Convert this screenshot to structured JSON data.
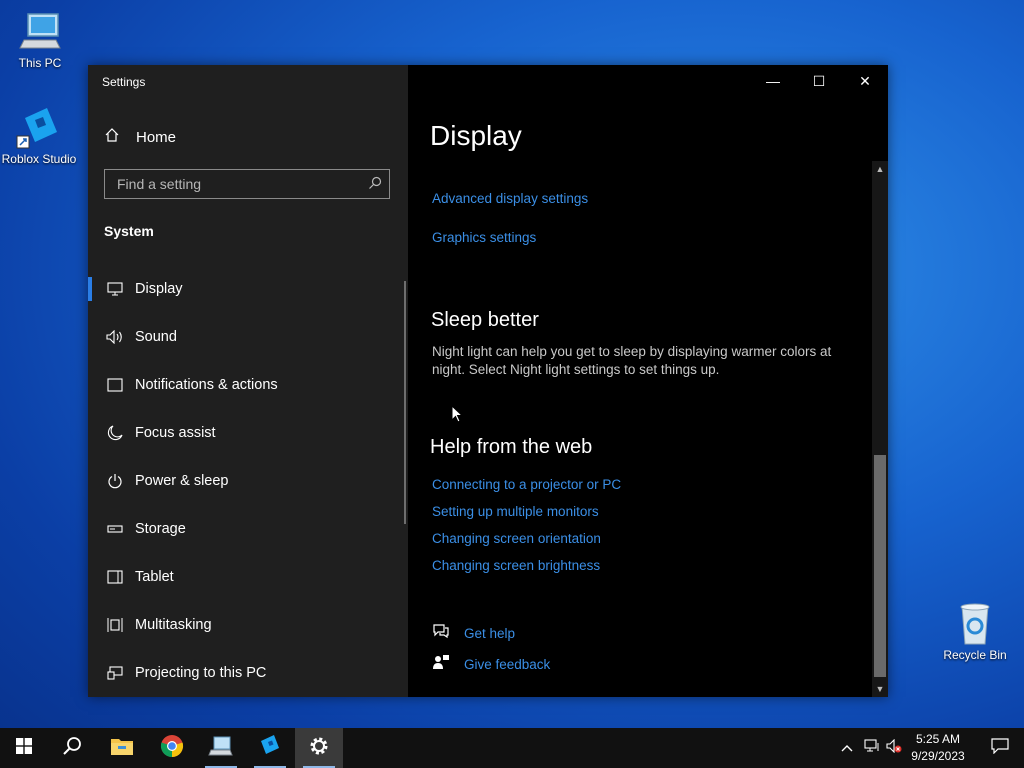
{
  "desktop": {
    "icons": [
      {
        "label": "This PC"
      },
      {
        "label": "Roblox Studio"
      },
      {
        "label": "Recycle Bin"
      }
    ]
  },
  "window": {
    "title": "Settings",
    "controls": {
      "minimize": "—",
      "maximize": "☐",
      "close": "✕"
    }
  },
  "sidebar": {
    "home_label": "Home",
    "search_placeholder": "Find a setting",
    "section_title": "System",
    "items": [
      {
        "label": "Display",
        "icon": "monitor-icon",
        "active": true
      },
      {
        "label": "Sound",
        "icon": "speaker-icon"
      },
      {
        "label": "Notifications & actions",
        "icon": "notification-icon"
      },
      {
        "label": "Focus assist",
        "icon": "moon-icon"
      },
      {
        "label": "Power & sleep",
        "icon": "power-icon"
      },
      {
        "label": "Storage",
        "icon": "storage-icon"
      },
      {
        "label": "Tablet",
        "icon": "tablet-icon"
      },
      {
        "label": "Multitasking",
        "icon": "multitasking-icon"
      },
      {
        "label": "Projecting to this PC",
        "icon": "projecting-icon"
      }
    ]
  },
  "content": {
    "title": "Display",
    "links_top": [
      "Advanced display settings",
      "Graphics settings"
    ],
    "sleep_better": {
      "heading": "Sleep better",
      "description": "Night light can help you get to sleep by displaying warmer colors at night. Select Night light settings to set things up."
    },
    "help": {
      "heading": "Help from the web",
      "links": [
        "Connecting to a projector or PC",
        "Setting up multiple monitors",
        "Changing screen orientation",
        "Changing screen brightness"
      ]
    },
    "get_help": "Get help",
    "give_feedback": "Give feedback"
  },
  "taskbar": {
    "apps": [
      "start",
      "search",
      "file-explorer",
      "chrome",
      "this-pc",
      "roblox-studio",
      "settings"
    ],
    "time": "5:25 AM",
    "date": "9/29/2023"
  },
  "colors": {
    "accent": "#2a7ee6",
    "link": "#3b8fe6",
    "sidebar_bg": "#1f1f1f",
    "content_bg": "#000000"
  }
}
